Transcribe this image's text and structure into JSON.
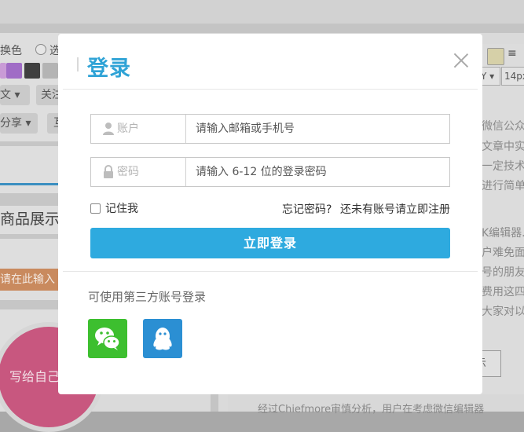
{
  "background": {
    "toolbar_left": {
      "color_label": "换色",
      "option_label": "选"
    },
    "swatches": [
      "#a06cc6",
      "#404040",
      "#b4b4b4"
    ],
    "chips": [
      "文",
      "关注",
      "分享",
      "互"
    ],
    "section_title": "商品展示",
    "input_tag": "请在此输入",
    "circle_text": "写给自己",
    "toolbar_right": {
      "select_1": "Y",
      "select_2": "14px"
    },
    "right_lines": [
      "微信公众",
      "文章中实",
      "一定技术",
      "进行简单",
      "",
      "K编辑器.",
      "户难免面",
      "号的朋友",
      "费用这四",
      "大家对以"
    ],
    "right_button": "示",
    "bottom_text": "经过Chiefmore审慎分析，用户在考虑微信编辑器"
  },
  "modal": {
    "title": "登录",
    "account": {
      "label": "账户",
      "placeholder": "请输入邮箱或手机号",
      "icon": "user-icon"
    },
    "password": {
      "label": "密码",
      "placeholder": "请输入 6-12 位的登录密码",
      "icon": "lock-icon"
    },
    "remember_label": "记住我",
    "forgot_label": "忘记密码?",
    "register_label": "还未有账号请立即注册",
    "submit_label": "立即登录",
    "third_party_title": "可使用第三方账号登录",
    "third_party": [
      {
        "name": "wechat",
        "icon": "wechat-icon",
        "color": "#3dbf2f"
      },
      {
        "name": "qq",
        "icon": "qq-icon",
        "color": "#2b8fd3"
      }
    ],
    "accent_color": "#2eaadf"
  }
}
